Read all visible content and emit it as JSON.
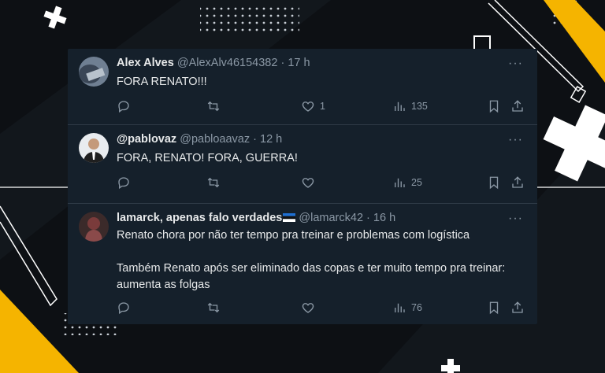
{
  "tweets": [
    {
      "name": "Alex Alves",
      "handle": "@AlexAlv46154382",
      "dot": "·",
      "time": "17 h",
      "more": "···",
      "text": "FORA RENATO!!!",
      "likes": "1",
      "views": "135"
    },
    {
      "name": "@pablovaz",
      "handle": "@pabloaavaz",
      "dot": "·",
      "time": "12 h",
      "more": "···",
      "text": "FORA, RENATO! FORA, GUERRA!",
      "likes": "",
      "views": "25"
    },
    {
      "name": "lamarck, apenas falo verdades",
      "handle": "@lamarck42",
      "dot": "·",
      "time": "16 h",
      "more": "···",
      "text": "Renato chora por não ter tempo pra treinar e problemas com logística\n\nTambém Renato após ser eliminado das copas e ter muito tempo pra treinar: aumenta as folgas",
      "likes": "",
      "views": "76"
    }
  ],
  "icons": {
    "reply": "reply-icon",
    "retweet": "retweet-icon",
    "like": "heart-icon",
    "views": "views-chart-icon",
    "bookmark": "bookmark-icon",
    "share": "share-icon",
    "flag": "flag-icon"
  },
  "colors": {
    "card_bg": "#15202b",
    "text": "#e7e9ea",
    "muted": "#8b98a5",
    "accent_yellow": "#f5b400",
    "page_bg": "#0d1014"
  }
}
